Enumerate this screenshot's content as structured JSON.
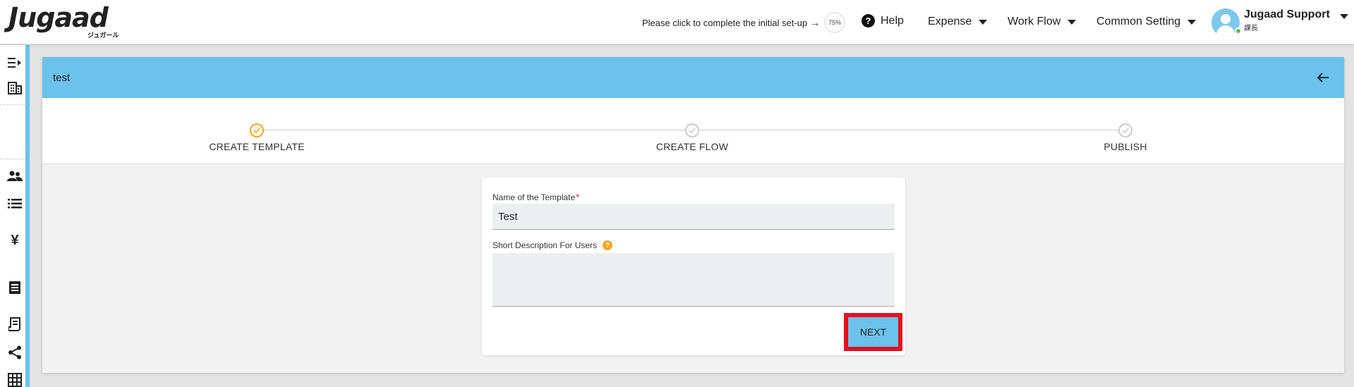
{
  "app": {
    "logo_text": "Jugaad",
    "logo_sub": "ジュガール"
  },
  "topbar": {
    "setup_text": "Please click to complete the initial set-up",
    "setup_arrow": "→",
    "setup_progress": "75%",
    "help_label": "Help",
    "menus": [
      {
        "label": "Expense"
      },
      {
        "label": "Work Flow"
      },
      {
        "label": "Common Setting"
      }
    ],
    "user": {
      "name": "Jugaad Support",
      "role": "課長",
      "status_color": "#5cc24a"
    }
  },
  "sidebar": {
    "icons": [
      "collapse-menu-icon",
      "building-icon",
      "users-icon",
      "list-icon",
      "yen-icon",
      "document-icon",
      "receipt-icon",
      "share-icon",
      "grid-icon"
    ],
    "accent_color": "#6cc1ed"
  },
  "panel": {
    "title": "test",
    "header_color": "#6cc1ed"
  },
  "stepper": {
    "steps": [
      {
        "label": "CREATE TEMPLATE",
        "state": "active"
      },
      {
        "label": "CREATE FLOW",
        "state": "inactive"
      },
      {
        "label": "PUBLISH",
        "state": "inactive"
      }
    ],
    "active_color": "#f5a623"
  },
  "form": {
    "template_name_label": "Name of the Template",
    "required_mark": "*",
    "template_name_value": "Test",
    "description_label": "Short Description For Users",
    "description_value": "",
    "info_icon_glyph": "?",
    "next_label": "NEXT"
  }
}
